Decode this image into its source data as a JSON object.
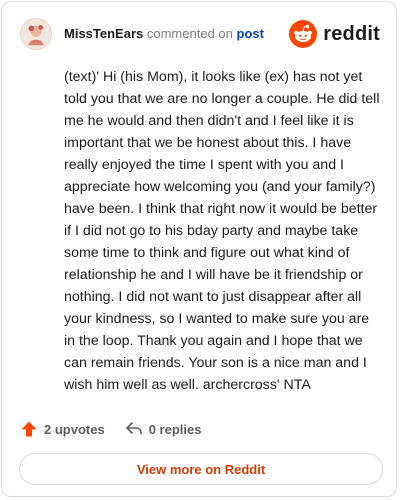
{
  "comment": {
    "author": "MissTenEars",
    "verb": "commented on",
    "post_link": "post",
    "body": "(text)' Hi (his Mom), it looks like (ex) has not yet told you that we are no longer a couple. He did tell me he would and then didn't and I feel like it is important that we be honest about this. I have really enjoyed the time I spent with you and I appreciate how welcoming you (and your family?) have been. I think that right now it would be better if I did not go to his bday party and maybe take some time to think and figure out what kind of relationship he and I will have be it friendship or nothing. I did not want to just disappear after all your kindness, so I wanted to make sure you are in the loop. Thank you again and I hope that we can remain friends. Your son is a nice man and I wish him well as well. archercross' NTA"
  },
  "brand": {
    "name": "reddit",
    "color": "#ff4500"
  },
  "actions": {
    "upvotes_label": "2 upvotes",
    "replies_label": "0 replies",
    "upvote_color": "#ff4500"
  },
  "footer": {
    "view_more_label": "View more on Reddit",
    "link_color": "#d93a00"
  }
}
